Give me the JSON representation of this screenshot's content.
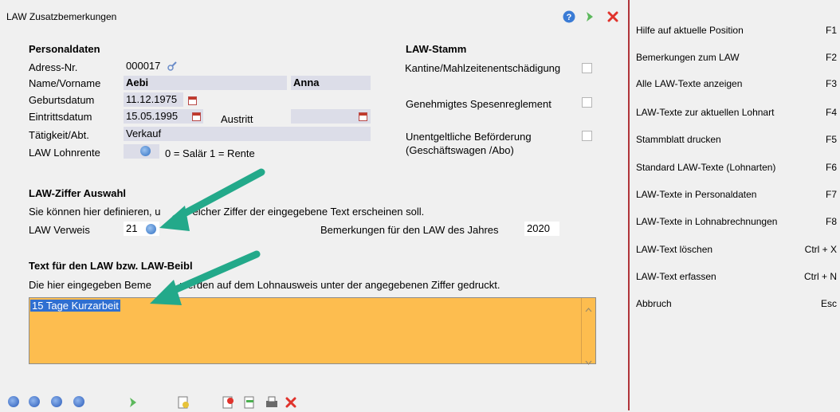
{
  "window": {
    "title": "LAW Zusatzbemerkungen"
  },
  "personal": {
    "heading": "Personaldaten",
    "adress_label": "Adress-Nr.",
    "adress_value": "000017",
    "name_label": "Name/Vorname",
    "last_name": "Aebi",
    "first_name": "Anna",
    "birth_label": "Geburtsdatum",
    "birth_value": "11.12.1975",
    "entry_label": "Eintrittsdatum",
    "entry_value": "15.05.1995",
    "exit_label": "Austritt",
    "exit_value": "",
    "activity_label": "Tätigkeit/Abt.",
    "activity_value": "Verkauf",
    "pension_label": "LAW Lohnrente",
    "pension_hint": "0 = Salär 1 = Rente"
  },
  "stamm": {
    "heading": "LAW-Stamm",
    "kantine": "Kantine/Mahlzeitenentschädigung",
    "spesen": "Genehmigtes Spesenreglement",
    "befoerderung_1": "Unentgeltliche Beförderung",
    "befoerderung_2": "(Geschäftswagen /Abo)"
  },
  "ziffer": {
    "heading": "LAW-Ziffer Auswahl",
    "desc_a": "Sie können hier definieren, u",
    "desc_b": "elcher Ziffer der eingegebene Text erscheinen soll.",
    "verweis_label": "LAW Verweis",
    "verweis_value": "21",
    "jahr_label": "Bemerkungen für den LAW des Jahres",
    "jahr_value": "2020"
  },
  "text": {
    "heading": "Text für den LAW bzw. LAW-Beibl",
    "desc_a": "Die hier eingegeben Beme",
    "desc_b": "werden auf dem Lohnausweis unter der angegebenen Ziffer gedruckt.",
    "value": "15 Tage Kurzarbeit"
  },
  "sidebar": {
    "items": [
      {
        "label": "Hilfe auf aktuelle Position",
        "key": "F1"
      },
      {
        "label": "Bemerkungen zum LAW",
        "key": "F2"
      },
      {
        "label": "Alle LAW-Texte anzeigen",
        "key": "F3"
      },
      {
        "label": "LAW-Texte zur aktuellen Lohnart",
        "key": "F4"
      },
      {
        "label": "Stammblatt drucken",
        "key": "F5"
      },
      {
        "label": "Standard LAW-Texte (Lohnarten)",
        "key": "F6"
      },
      {
        "label": "LAW-Texte in Personaldaten",
        "key": "F7"
      },
      {
        "label": "LAW-Texte in Lohnabrechnungen",
        "key": "F8"
      },
      {
        "label": "LAW-Text löschen",
        "key": "Ctrl + X"
      },
      {
        "label": "LAW-Text erfassen",
        "key": "Ctrl + N"
      },
      {
        "label": "Abbruch",
        "key": "Esc"
      }
    ]
  },
  "icons": {
    "help": "help-icon",
    "next": "next-icon",
    "close": "close-icon",
    "search": "search-icon",
    "calendar": "calendar-icon",
    "first": "first-record-icon",
    "prev": "previous-record-icon",
    "nextrec": "next-record-icon",
    "last": "last-record-icon",
    "go": "go-icon",
    "new": "new-document-icon",
    "delete": "delete-document-icon",
    "export": "export-icon",
    "print": "print-icon",
    "cancel": "cancel-icon"
  },
  "colors": {
    "field": "#dcdde8",
    "textarea": "#fdbd4f",
    "divider": "#b0343a",
    "arrow": "#23a98a",
    "selection": "#2f6fd1"
  }
}
